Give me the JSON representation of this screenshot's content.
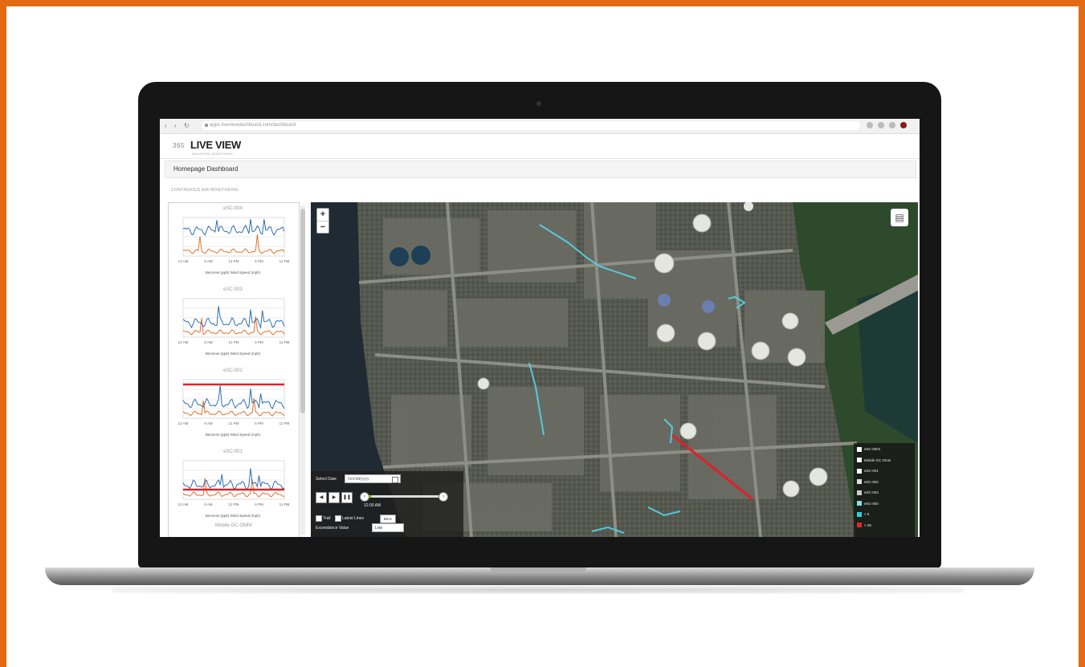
{
  "browser": {
    "url": "apps.liveviewdashboard.com/dashboard",
    "avatar_color": "#8b1a1a"
  },
  "app": {
    "logo_mark": "365",
    "logo_text": "LIVE VIEW",
    "logo_sub": "INDUSTRIAL MONITORING",
    "page_title": "Homepage Dashboard",
    "section_label": "CONTINUOUS AIR MONITORING"
  },
  "charts": [
    {
      "title": "eSC-004",
      "legend": "Benzene (ppb)   Wind Speed (mph)",
      "ticks": [
        "12 AM",
        "6 AM",
        "12 PM",
        "6 PM",
        "11 PM"
      ],
      "color_primary": "#2f6fb8",
      "color_secondary": "#e0732a"
    },
    {
      "title": "eSC-003",
      "legend": "Benzene (ppb)   Wind Speed (mph)",
      "ticks": [
        "12 AM",
        "6 AM",
        "12 PM",
        "6 PM",
        "11 PM"
      ],
      "color_primary": "#2f6fb8",
      "color_secondary": "#e0732a"
    },
    {
      "title": "eSC-002",
      "legend": "Benzene (ppb)   Wind Speed (mph)",
      "ticks": [
        "12 AM",
        "6 AM",
        "12 PM",
        "6 PM",
        "11 PM"
      ],
      "color_primary": "#2f6fb8",
      "color_secondary": "#e0732a",
      "threshold_color": "#d9262b"
    },
    {
      "title": "eSC-001",
      "legend": "Benzene (ppb)   Wind Speed (mph)",
      "ticks": [
        "12 AM",
        "6 AM",
        "12 PM",
        "6 PM",
        "11 PM"
      ],
      "color_primary": "#2f6fb8",
      "color_secondary": "#e0732a",
      "threshold_color": "#d9262b"
    }
  ],
  "sidebar_more": "Mobile GC-OMNI",
  "map": {
    "zoom_in": "+",
    "zoom_out": "−",
    "layers_icon": "layers-icon"
  },
  "controls": {
    "select_date_label": "Select Date",
    "date_value": "mm/dd/yyyy",
    "play_buttons": [
      "◀",
      "▶",
      "❚❚"
    ],
    "time_value": "12:00 AM",
    "trail_label": "Trail",
    "latest_label": "Latest Lines",
    "tooltip": "Benz",
    "exceedance_label": "Exceedance Value",
    "exceedance_value": "Low"
  },
  "legend": [
    {
      "label": "eSC-0001",
      "color": "#ffffff"
    },
    {
      "label": "Mobile GC Omni",
      "color": "#ffffff"
    },
    {
      "label": "eSC-001",
      "color": "#ffffff"
    },
    {
      "label": "eSC-002",
      "color": "#dddddd"
    },
    {
      "label": "eSC-003",
      "color": "#cccccc"
    },
    {
      "label": "eSC-004",
      "color": "#7ee0e0"
    },
    {
      "label": "< 5",
      "color": "#2ad0e0"
    },
    {
      "label": "> 30",
      "color": "#e02a2a"
    }
  ],
  "colors": {
    "frame": "#e26a12",
    "accent_cyan": "#52d6e6",
    "alert_red": "#e0202a"
  }
}
